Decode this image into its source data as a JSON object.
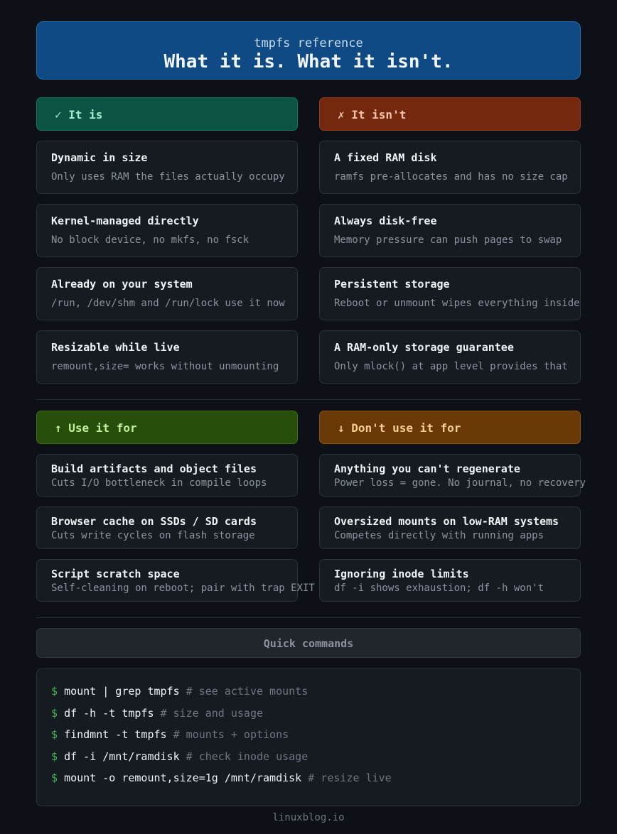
{
  "header": {
    "subtitle": "tmpfs reference",
    "title": "What it is. What it isn't."
  },
  "is_section": {
    "is": {
      "heading": "✓ It is",
      "items": [
        {
          "title": "Dynamic in size",
          "desc": "Only uses RAM the files actually occupy"
        },
        {
          "title": "Kernel-managed directly",
          "desc": "No block device, no mkfs, no fsck"
        },
        {
          "title": "Already on your system",
          "desc": "/run, /dev/shm and /run/lock use it now"
        },
        {
          "title": "Resizable while live",
          "desc": "remount,size= works without unmounting"
        }
      ]
    },
    "isnt": {
      "heading": "✗ It isn't",
      "items": [
        {
          "title": "A fixed RAM disk",
          "desc": "ramfs pre-allocates and has no size cap"
        },
        {
          "title": "Always disk-free",
          "desc": "Memory pressure can push pages to swap"
        },
        {
          "title": "Persistent storage",
          "desc": "Reboot or unmount wipes everything inside"
        },
        {
          "title": "A RAM-only storage guarantee",
          "desc": "Only mlock() at app level provides that"
        }
      ]
    }
  },
  "use_section": {
    "use": {
      "heading": "↑ Use it for",
      "items": [
        {
          "title": "Build artifacts and object files",
          "desc": "Cuts I/O bottleneck in compile loops"
        },
        {
          "title": "Browser cache on SSDs / SD cards",
          "desc": "Cuts write cycles on flash storage"
        },
        {
          "title": "Script scratch space",
          "desc": "Self-cleaning on reboot; pair with trap EXIT"
        }
      ]
    },
    "dont": {
      "heading": "↓ Don't use it for",
      "items": [
        {
          "title": "Anything you can't regenerate",
          "desc": "Power loss = gone. No journal, no recovery"
        },
        {
          "title": "Oversized mounts on low-RAM systems",
          "desc": "Competes directly with running apps"
        },
        {
          "title": "Ignoring inode limits",
          "desc": "df -i shows exhaustion; df -h won't"
        }
      ]
    }
  },
  "commands": {
    "heading": "Quick commands",
    "prompt": "$",
    "lines": [
      {
        "cmd": "mount | grep tmpfs",
        "comment": "# see active mounts"
      },
      {
        "cmd": "df -h -t tmpfs",
        "comment": "# size and usage"
      },
      {
        "cmd": "findmnt -t tmpfs",
        "comment": "# mounts + options"
      },
      {
        "cmd": "df -i /mnt/ramdisk",
        "comment": "# check inode usage"
      },
      {
        "cmd": "mount -o remount,size=1g /mnt/ramdisk",
        "comment": "# resize live"
      }
    ]
  },
  "footer": {
    "text": "linuxblog.io"
  }
}
